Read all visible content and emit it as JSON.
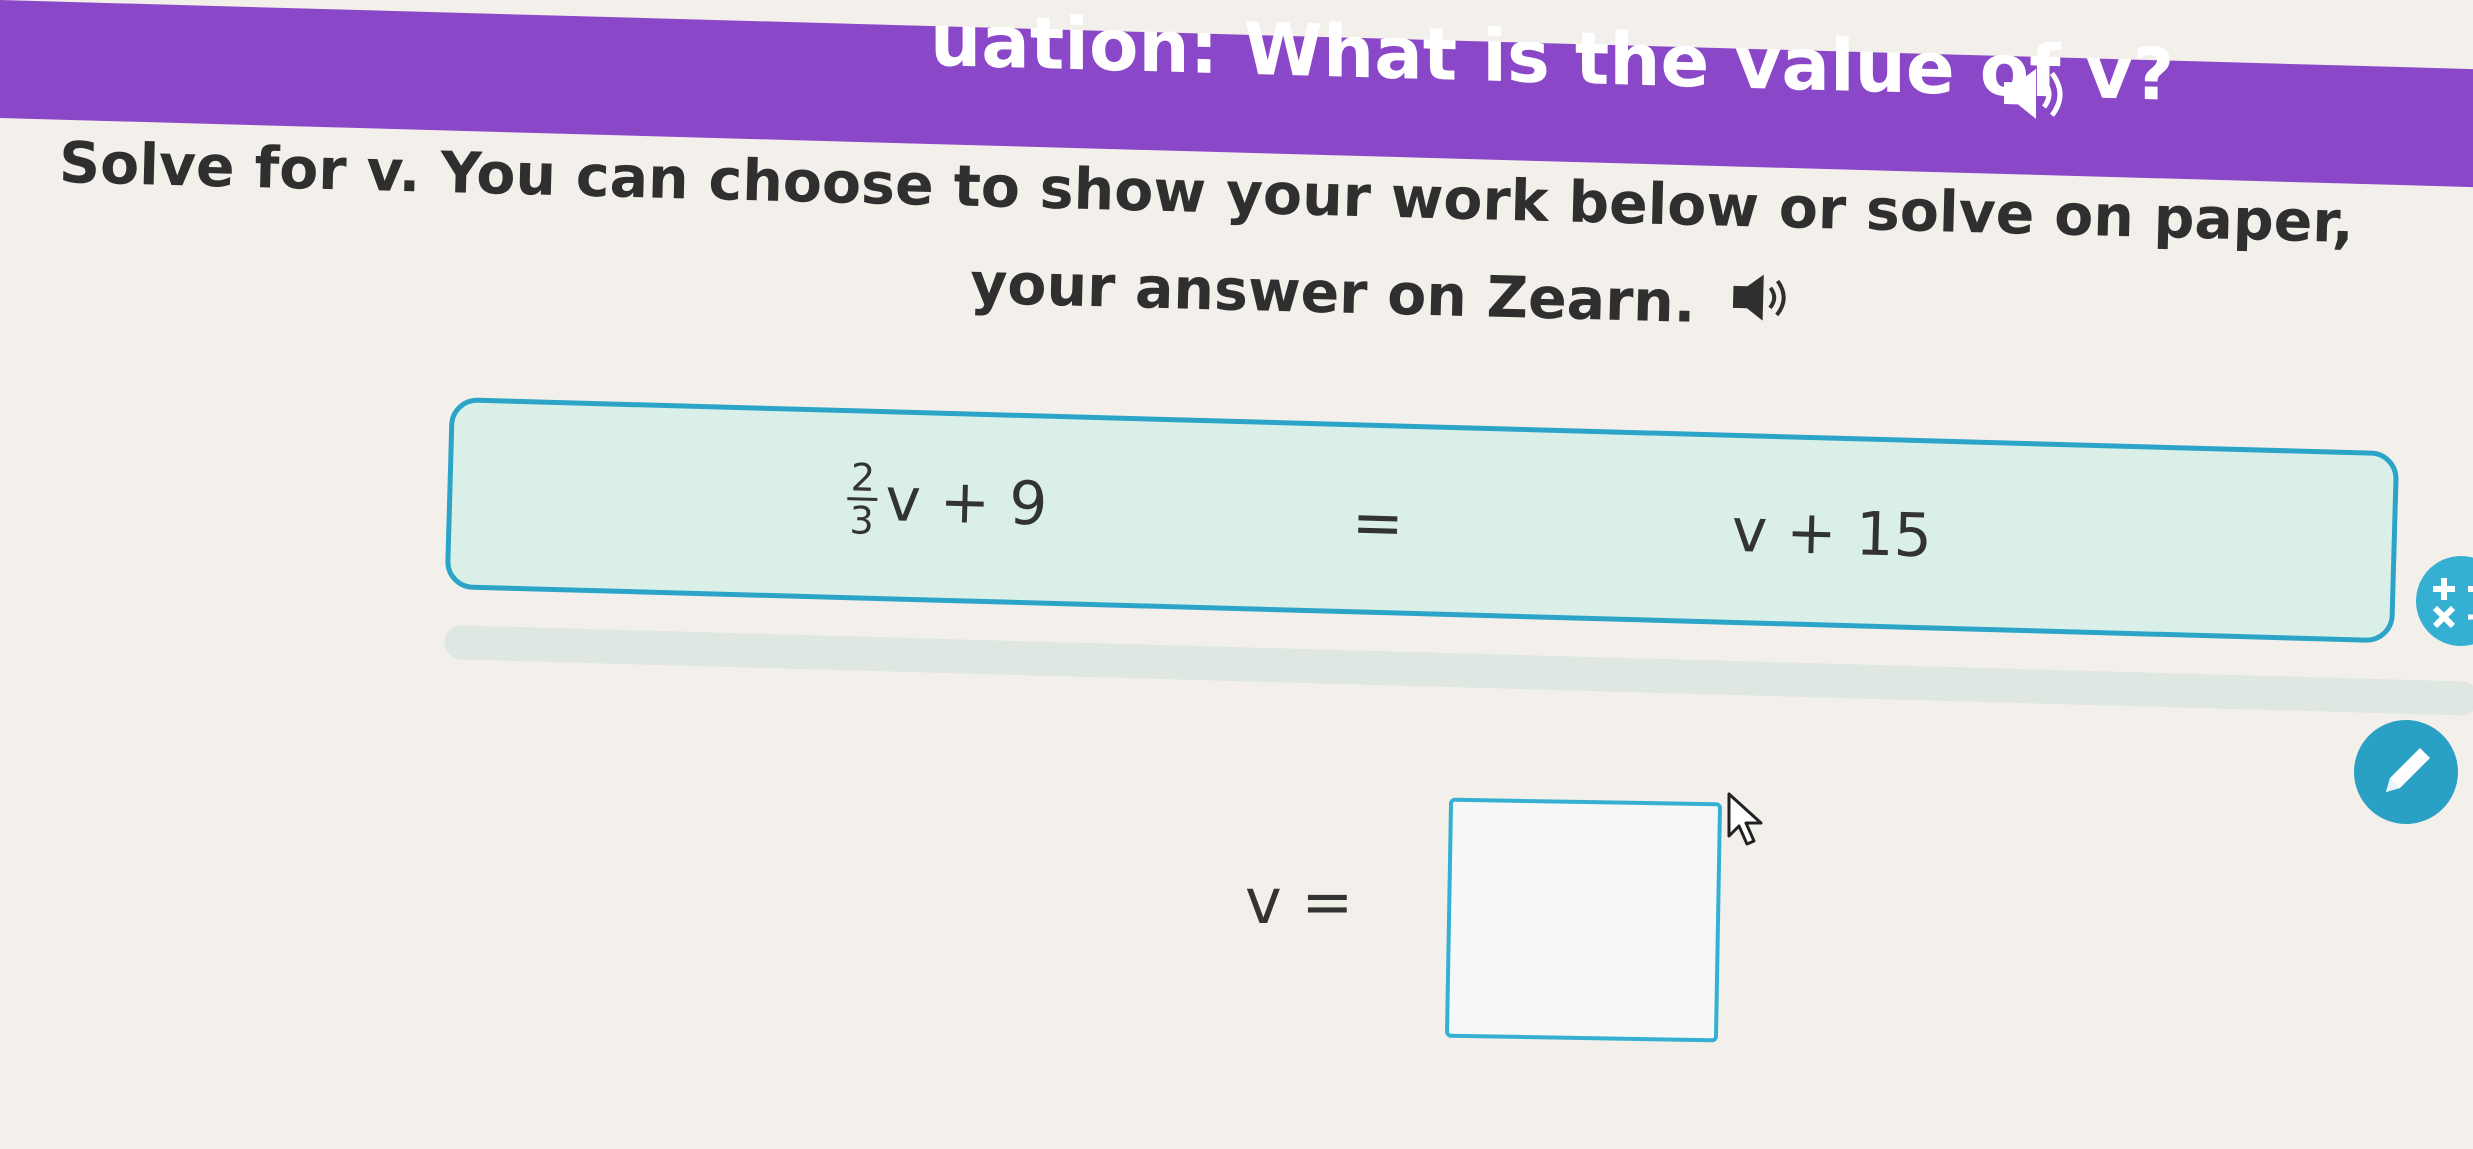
{
  "header": {
    "banner_text": "uation: What is the value of v?",
    "banner_audio_icon": "speaker-icon",
    "color": "#8a48c8"
  },
  "instructions": {
    "line1": "Solve for v. You can choose to show your work below or solve on paper,",
    "line2": "your answer on Zearn.",
    "audio_icon": "speaker-icon"
  },
  "equation": {
    "left_numerator": "2",
    "left_denominator": "3",
    "left_rest": "v + 9",
    "equals": "=",
    "right": "v + 15",
    "border_color": "#2ba4c8",
    "fill_color": "#d9efe8"
  },
  "answer": {
    "label": "v  =",
    "value": ""
  },
  "tools": {
    "operations_icon": "plus-minus-times-divide-icon",
    "pencil_icon": "pencil-icon",
    "cursor_icon": "mouse-cursor-icon"
  }
}
